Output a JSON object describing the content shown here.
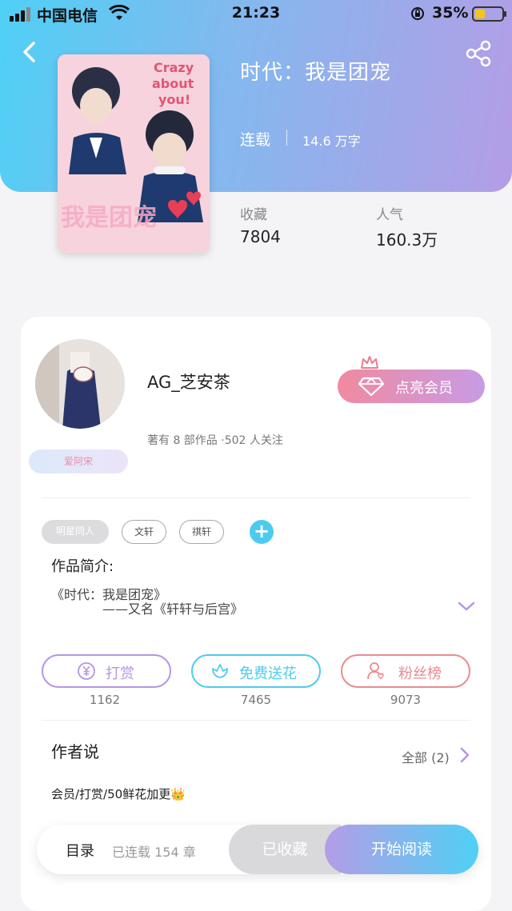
{
  "status_bar": {
    "carrier": "中国电信",
    "time": "21:23",
    "battery_percent": "35%",
    "battery_level": 0.35,
    "battery_color": "#f5c518"
  },
  "header": {
    "back_icon": "chevron-left-icon",
    "share_icon": "share-icon"
  },
  "book": {
    "title": "时代：我是团宠",
    "status": "连载",
    "word_count": "14.6 万字",
    "cover_text_top": "Crazy about you!",
    "cover_text_bottom": "我是团宠",
    "stats": [
      {
        "label": "收藏",
        "value": "7804"
      },
      {
        "label": "人气",
        "value": "160.3万"
      }
    ]
  },
  "author": {
    "name": "AG_芝安茶",
    "meta": "著有 8 部作品 ·502 人关注",
    "fan_badge": "爱阿宋",
    "vip_button": "点亮会员"
  },
  "tags": [
    "明星同人",
    "文轩",
    "祺轩"
  ],
  "intro": {
    "heading": "作品简介:",
    "line1": "《时代：我是团宠》",
    "line2": "——又名《轩轩与后宫》"
  },
  "actions": [
    {
      "label": "打赏",
      "count": "1162",
      "color": "#b595e6"
    },
    {
      "label": "免费送花",
      "count": "7465",
      "color": "#4dcbef"
    },
    {
      "label": "粉丝榜",
      "count": "9073",
      "color": "#ec8a8f"
    }
  ],
  "author_says": {
    "heading": "作者说",
    "all_label": "全部 (2)",
    "note": "会员/打赏/50鲜花加更👑"
  },
  "bottom_bar": {
    "catalog": "目录",
    "chapters": "已连载 154 章",
    "collected": "已收藏",
    "start_reading": "开始阅读"
  },
  "colors": {
    "header_gradient_start": "#4fd0f5",
    "header_gradient_end": "#b49de6",
    "accent_purple": "#b595e6",
    "accent_cyan": "#4dcbef",
    "accent_pink": "#ec8a8f"
  }
}
